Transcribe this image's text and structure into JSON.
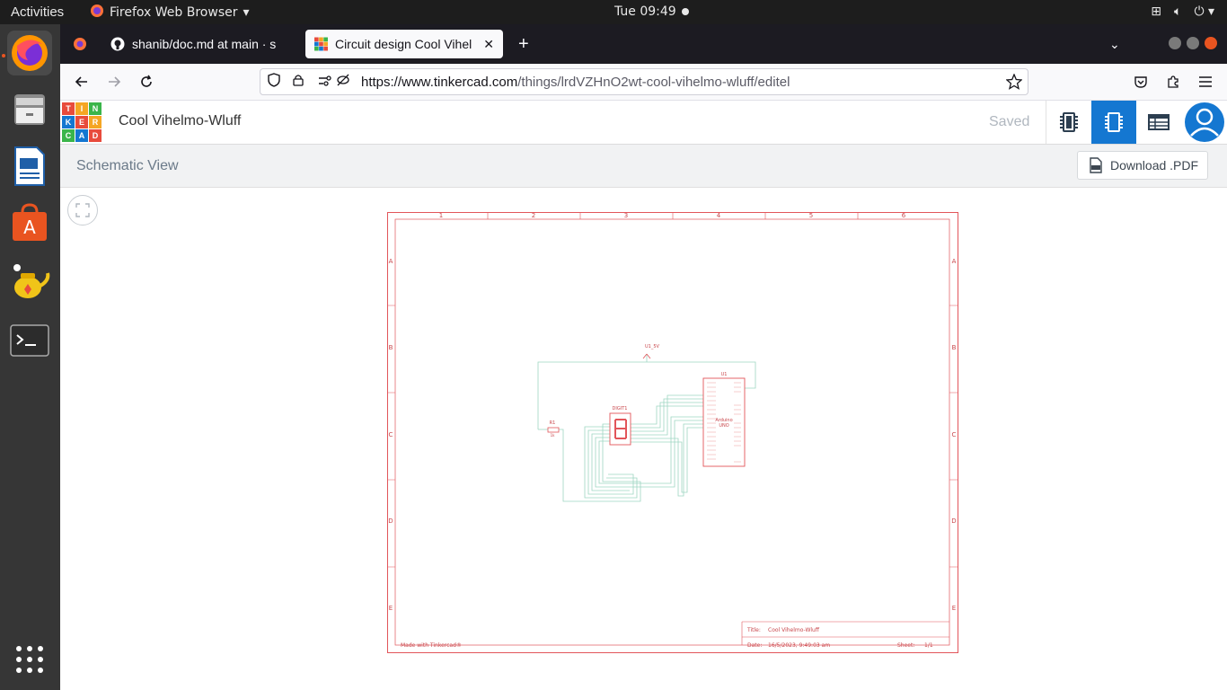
{
  "topbar": {
    "activities": "Activities",
    "app_name": "Firefox Web Browser",
    "clock": "Tue 09:49"
  },
  "dock": {
    "items": [
      "firefox-icon",
      "files-icon",
      "writer-icon",
      "software-icon",
      "teapot-icon",
      "terminal-icon",
      "app-grid-icon"
    ]
  },
  "browser": {
    "tabs": [
      {
        "label": "shanib/doc.md at main · s",
        "icon": "github-icon"
      },
      {
        "label": "Circuit design Cool Vihelm",
        "icon": "tinkercad-icon"
      }
    ],
    "url_host": "https://www.tinkercad.com",
    "url_path": "/things/lrdVZHnO2wt-cool-vihelmo-wluff/editel"
  },
  "tinkercad": {
    "logo_letters": [
      "T",
      "I",
      "N",
      "K",
      "E",
      "R",
      "C",
      "A",
      "D"
    ],
    "logo_colors": [
      "#e84b3c",
      "#f5a623",
      "#3ab54a",
      "#1477d1",
      "#e84b3c",
      "#f5a623",
      "#3ab54a",
      "#1477d1",
      "#e84b3c"
    ],
    "design_title": "Cool Vihelmo-Wluff",
    "saved_label": "Saved",
    "accent": "#1477d1"
  },
  "schematic": {
    "view_title": "Schematic View",
    "download_label": "Download .PDF",
    "col_labels": [
      "1",
      "2",
      "3",
      "4",
      "5",
      "6"
    ],
    "row_labels": [
      "A",
      "B",
      "C",
      "D",
      "E"
    ],
    "net_label": "U1_5V",
    "r1_label": "R1",
    "r1_value": "1k",
    "digit_label": "DIGIT1",
    "u1_label": "U1",
    "arduino_label1": "Arduino",
    "arduino_label2": "UNO",
    "made_with": "Made with Tinkercad®",
    "title_key": "Title:",
    "title_val": "Cool Vihelmo-Wluff",
    "date_key": "Date:",
    "date_val": "16/5/2023, 9:49:03 am",
    "sheet_key": "Sheet:",
    "sheet_val": "1/1",
    "border_color": "#e2555a",
    "wire_color": "#9ed6c2"
  }
}
